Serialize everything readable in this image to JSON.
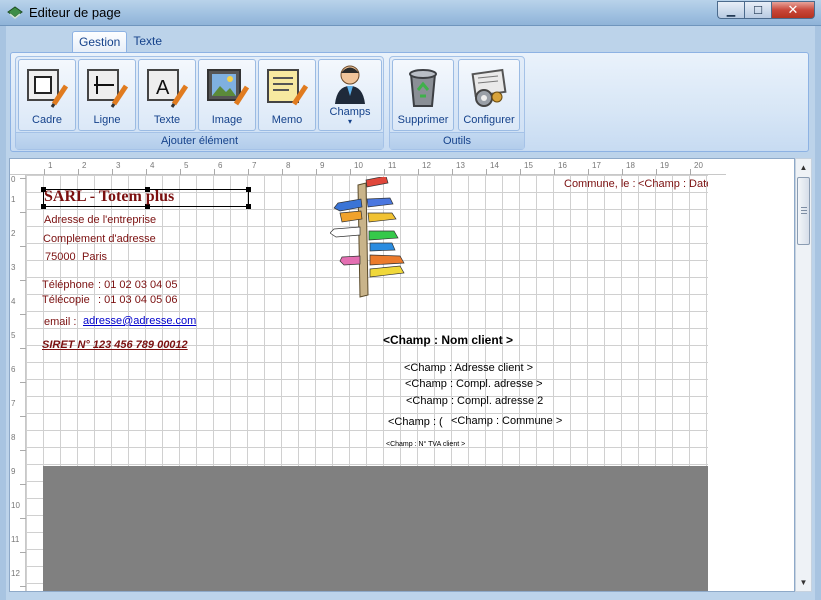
{
  "window": {
    "title": "Editeur de page",
    "minimize_icon": "minimize-icon",
    "maximize_icon": "maximize-icon",
    "close_icon": "close-icon"
  },
  "ribbon": {
    "tabs": [
      {
        "label": "Gestion",
        "active": true
      },
      {
        "label": "Texte",
        "active": false
      }
    ],
    "groups": {
      "add_element": {
        "label": "Ajouter élément",
        "buttons": {
          "cadre": "Cadre",
          "ligne": "Ligne",
          "texte": "Texte",
          "image": "Image",
          "memo": "Memo",
          "champs": "Champs",
          "champs_dropdown": "▾"
        }
      },
      "tools": {
        "label": "Outils",
        "buttons": {
          "supprimer": "Supprimer",
          "configurer": "Configurer"
        }
      }
    }
  },
  "ruler": {
    "top": [
      "1",
      "2",
      "3",
      "4",
      "5",
      "6",
      "7",
      "8",
      "9",
      "10",
      "11",
      "12",
      "13",
      "14",
      "15",
      "16",
      "17",
      "18",
      "19",
      "20"
    ],
    "left": [
      "0",
      "1",
      "2",
      "3",
      "4",
      "5",
      "6",
      "7",
      "8",
      "9",
      "10",
      "11",
      "12"
    ]
  },
  "page": {
    "company": {
      "name": "SARL - Totem plus",
      "address": "Adresse de l'entreprise",
      "address_complement": "Complement d'adresse",
      "postcode": "75000",
      "city": "Paris",
      "phone_label": "Téléphone",
      "phone": ": 01 02 03 04 05",
      "fax_label": "Télécopie",
      "fax": ": 01 03 04 05 06",
      "email_label": "email :",
      "email": "adresse@adresse.com",
      "siret": "SIRET N° 123 456 789 00012"
    },
    "date_line": {
      "label": "Commune, le :",
      "field": "<Champ : Date"
    },
    "client": {
      "name_field": "<Champ : Nom client >",
      "address_field": "<Champ : Adresse client >",
      "complement_field": "<Champ : Compl. adresse >",
      "complement2_field": "<Champ : Compl. adresse 2",
      "postcode_field": "<Champ : (",
      "city_field": "<Champ : Commune >",
      "vat_field": "<Champ : N° TVA client >"
    },
    "image_icon": "signpost-image",
    "colors": {
      "company_text": "#7b1010",
      "link": "#0000cc",
      "gray_area": "#808080"
    }
  }
}
